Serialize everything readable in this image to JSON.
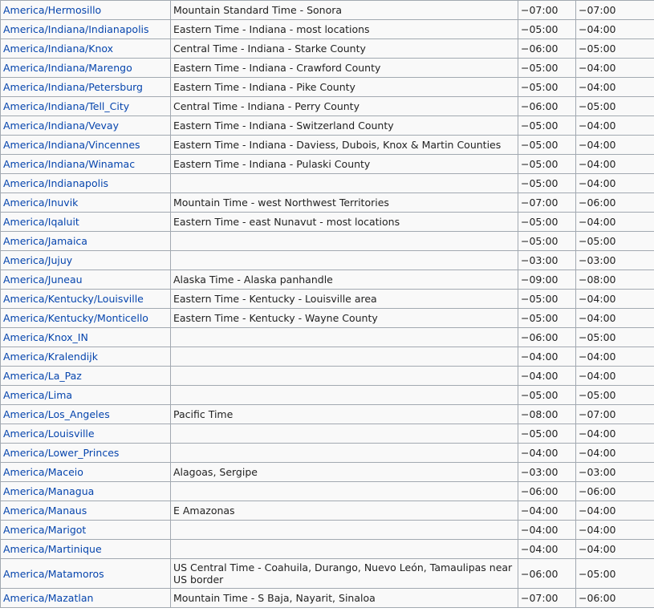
{
  "colors": {
    "link": "#0645ad",
    "border": "#a2a9b1",
    "cell_bg": "#f9f9f9",
    "text": "#222222"
  },
  "rows": [
    {
      "tz": "America/Hermosillo",
      "desc": "Mountain Standard Time - Sonora",
      "utc": "−07:00",
      "dst": "−07:00"
    },
    {
      "tz": "America/Indiana/Indianapolis",
      "desc": "Eastern Time - Indiana - most locations",
      "utc": "−05:00",
      "dst": "−04:00"
    },
    {
      "tz": "America/Indiana/Knox",
      "desc": "Central Time - Indiana - Starke County",
      "utc": "−06:00",
      "dst": "−05:00"
    },
    {
      "tz": "America/Indiana/Marengo",
      "desc": "Eastern Time - Indiana - Crawford County",
      "utc": "−05:00",
      "dst": "−04:00"
    },
    {
      "tz": "America/Indiana/Petersburg",
      "desc": "Eastern Time - Indiana - Pike County",
      "utc": "−05:00",
      "dst": "−04:00"
    },
    {
      "tz": "America/Indiana/Tell_City",
      "desc": "Central Time - Indiana - Perry County",
      "utc": "−06:00",
      "dst": "−05:00"
    },
    {
      "tz": "America/Indiana/Vevay",
      "desc": "Eastern Time - Indiana - Switzerland County",
      "utc": "−05:00",
      "dst": "−04:00"
    },
    {
      "tz": "America/Indiana/Vincennes",
      "desc": "Eastern Time - Indiana - Daviess, Dubois, Knox & Martin Counties",
      "utc": "−05:00",
      "dst": "−04:00"
    },
    {
      "tz": "America/Indiana/Winamac",
      "desc": "Eastern Time - Indiana - Pulaski County",
      "utc": "−05:00",
      "dst": "−04:00"
    },
    {
      "tz": "America/Indianapolis",
      "desc": "",
      "utc": "−05:00",
      "dst": "−04:00"
    },
    {
      "tz": "America/Inuvik",
      "desc": "Mountain Time - west Northwest Territories",
      "utc": "−07:00",
      "dst": "−06:00"
    },
    {
      "tz": "America/Iqaluit",
      "desc": "Eastern Time - east Nunavut - most locations",
      "utc": "−05:00",
      "dst": "−04:00"
    },
    {
      "tz": "America/Jamaica",
      "desc": "",
      "utc": "−05:00",
      "dst": "−05:00"
    },
    {
      "tz": "America/Jujuy",
      "desc": "",
      "utc": "−03:00",
      "dst": "−03:00"
    },
    {
      "tz": "America/Juneau",
      "desc": "Alaska Time - Alaska panhandle",
      "utc": "−09:00",
      "dst": "−08:00"
    },
    {
      "tz": "America/Kentucky/Louisville",
      "desc": "Eastern Time - Kentucky - Louisville area",
      "utc": "−05:00",
      "dst": "−04:00"
    },
    {
      "tz": "America/Kentucky/Monticello",
      "desc": "Eastern Time - Kentucky - Wayne County",
      "utc": "−05:00",
      "dst": "−04:00"
    },
    {
      "tz": "America/Knox_IN",
      "desc": "",
      "utc": "−06:00",
      "dst": "−05:00"
    },
    {
      "tz": "America/Kralendijk",
      "desc": "",
      "utc": "−04:00",
      "dst": "−04:00"
    },
    {
      "tz": "America/La_Paz",
      "desc": "",
      "utc": "−04:00",
      "dst": "−04:00"
    },
    {
      "tz": "America/Lima",
      "desc": "",
      "utc": "−05:00",
      "dst": "−05:00"
    },
    {
      "tz": "America/Los_Angeles",
      "desc": "Pacific Time",
      "utc": "−08:00",
      "dst": "−07:00"
    },
    {
      "tz": "America/Louisville",
      "desc": "",
      "utc": "−05:00",
      "dst": "−04:00"
    },
    {
      "tz": "America/Lower_Princes",
      "desc": "",
      "utc": "−04:00",
      "dst": "−04:00"
    },
    {
      "tz": "America/Maceio",
      "desc": "Alagoas, Sergipe",
      "utc": "−03:00",
      "dst": "−03:00"
    },
    {
      "tz": "America/Managua",
      "desc": "",
      "utc": "−06:00",
      "dst": "−06:00"
    },
    {
      "tz": "America/Manaus",
      "desc": "E Amazonas",
      "utc": "−04:00",
      "dst": "−04:00"
    },
    {
      "tz": "America/Marigot",
      "desc": "",
      "utc": "−04:00",
      "dst": "−04:00"
    },
    {
      "tz": "America/Martinique",
      "desc": "",
      "utc": "−04:00",
      "dst": "−04:00"
    },
    {
      "tz": "America/Matamoros",
      "desc": "US Central Time - Coahuila, Durango, Nuevo León, Tamaulipas near US border",
      "utc": "−06:00",
      "dst": "−05:00"
    },
    {
      "tz": "America/Mazatlan",
      "desc": "Mountain Time - S Baja, Nayarit, Sinaloa",
      "utc": "−07:00",
      "dst": "−06:00"
    }
  ]
}
